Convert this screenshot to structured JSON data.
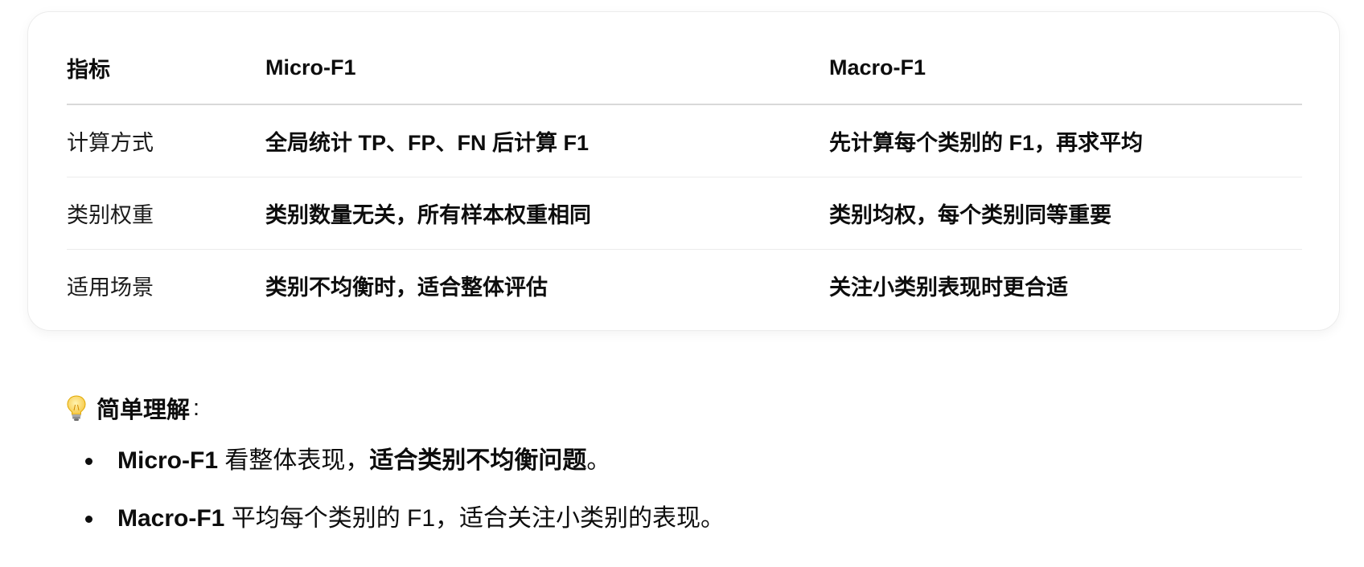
{
  "table": {
    "headers": [
      "指标",
      "Micro-F1",
      "Macro-F1"
    ],
    "rows": [
      {
        "metric": "计算方式",
        "micro": "全局统计 TP、FP、FN 后计算 F1",
        "macro": "先计算每个类别的 F1，再求平均"
      },
      {
        "metric": "类别权重",
        "micro": "类别数量无关，所有样本权重相同",
        "macro": "类别均权，每个类别同等重要"
      },
      {
        "metric": "适用场景",
        "micro": "类别不均衡时，适合整体评估",
        "macro": "关注小类别表现时更合适"
      }
    ]
  },
  "tip": {
    "icon": "lightbulb-icon",
    "title": "简单理解",
    "colon": ":"
  },
  "bullets": [
    {
      "bold": "Micro-F1",
      "text": " 看整体表现，",
      "bold2": "适合类别不均衡问题",
      "end": "。"
    },
    {
      "bold": "Macro-F1",
      "text": " 平均每个类别的 F1，适合关注小类别的表现。"
    }
  ],
  "colors": {
    "text": "#0d0d0d",
    "border": "#ececec",
    "bulb": "#f7c948"
  }
}
